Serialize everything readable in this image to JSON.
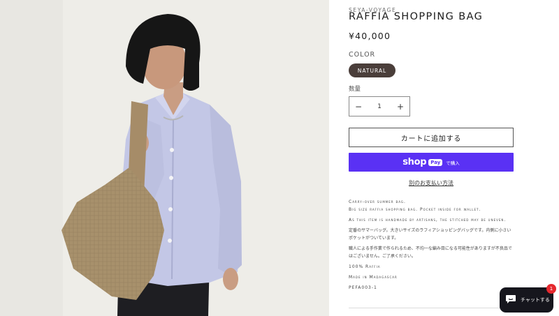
{
  "product": {
    "vendor": "SEYA-VOYAGE",
    "title": "RAFFIA SHOPPING BAG",
    "price": "¥40,000",
    "image_alt": "Model wearing a lavender shirt carrying a raffia shopping bag"
  },
  "variant": {
    "label": "COLOR",
    "selected": "NATURAL"
  },
  "quantity": {
    "label": "数量",
    "minus": "−",
    "value": "1",
    "plus": "+"
  },
  "actions": {
    "add_to_cart": "カートに追加する",
    "shop_pay_word": "shop",
    "shop_pay_badge": "Pay",
    "shop_pay_suffix": "で購入",
    "more_payment": "別のお支払い方法"
  },
  "description": {
    "line1": "Carry-over summer bag.",
    "line2": "Big size raffia shopping bag. Pocket inside for wallet.",
    "line3": "As this item is handmade by artisans, the stitched may be uneven.",
    "line4": "定番のサマーバッグ。大きいサイズのラフィアショッピングバッグです。内側に小さいポケットがついています。",
    "line5": "職人による手作業で作られるため、不均一な編み目になる可能性がありますが不良品ではございません。ご了承ください。",
    "material": "100% Raffia",
    "origin": "Made in Madagascar",
    "sku": "PEFA003-1"
  },
  "chat": {
    "label": "チャットする",
    "badge_count": "1"
  },
  "colors": {
    "variant_pill": "#4a3e3a",
    "shop_pay": "#5a31f4",
    "chat_bg": "#16161d",
    "chat_badge": "#e5282e"
  }
}
